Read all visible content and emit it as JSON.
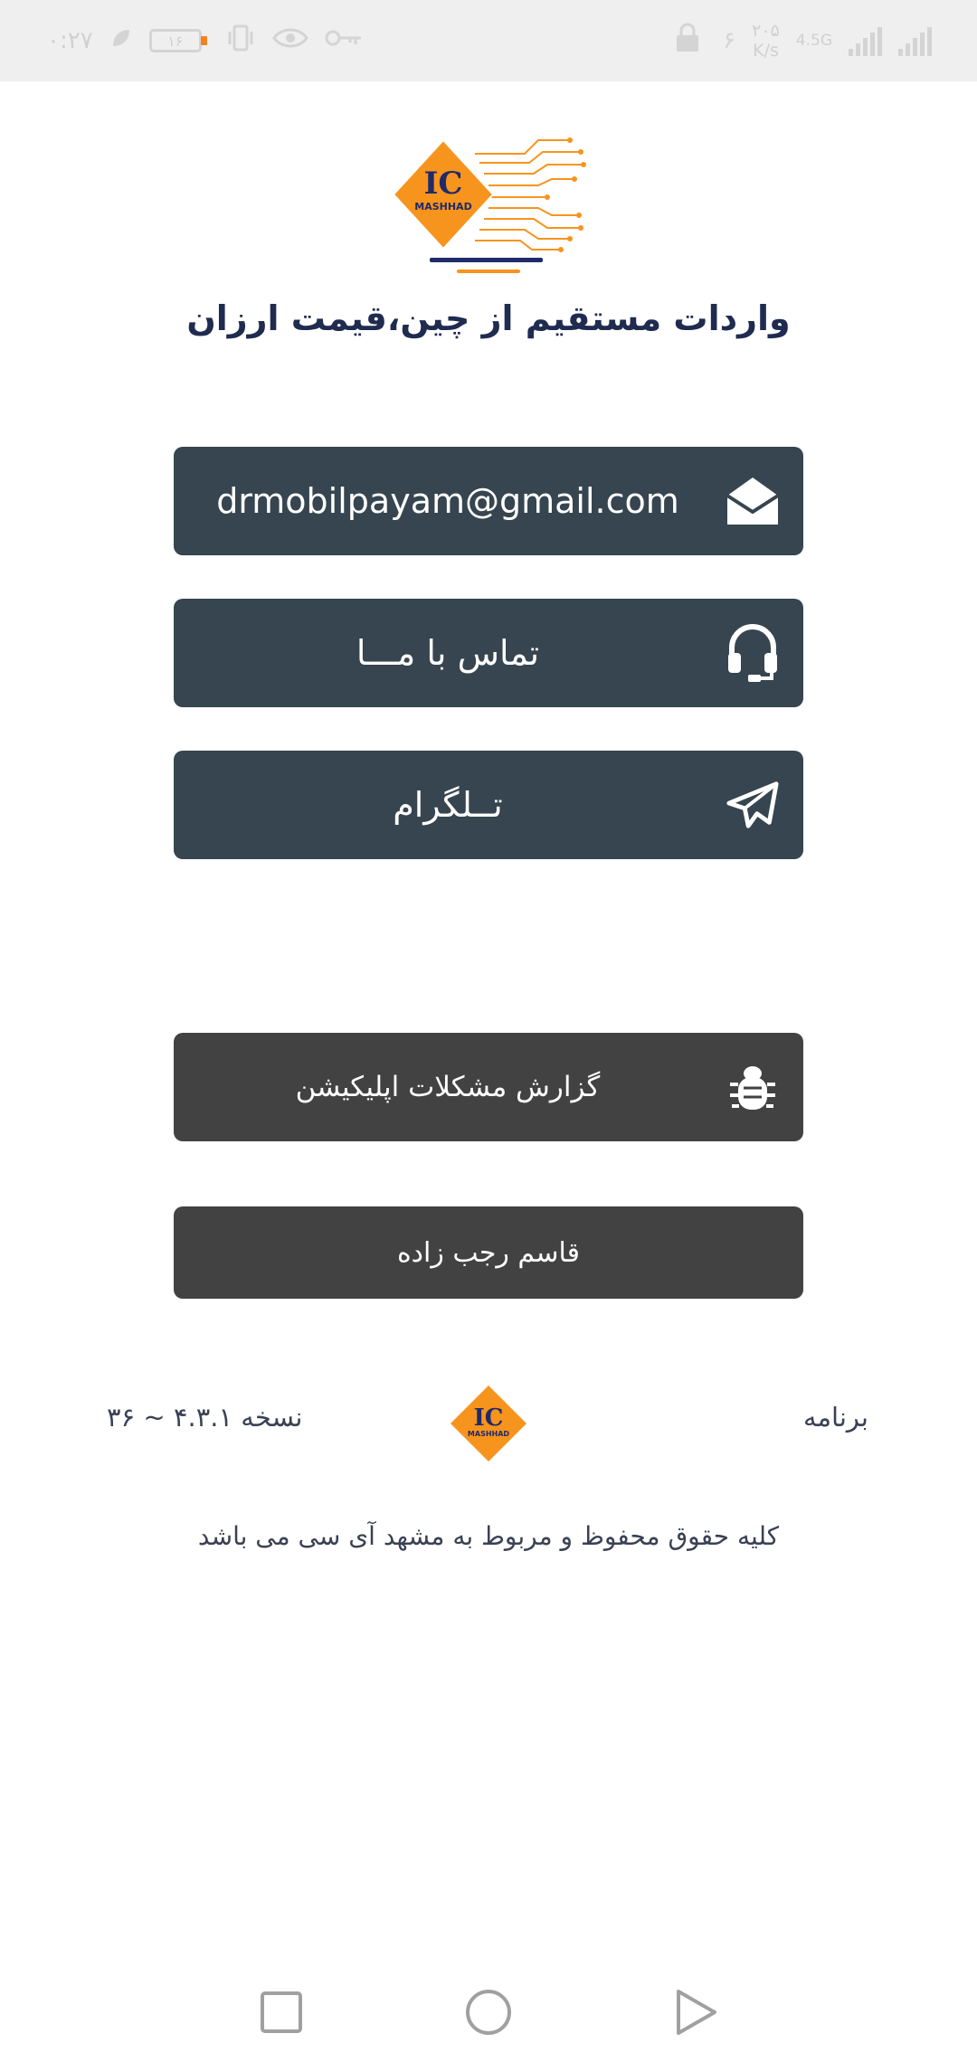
{
  "status_bar": {
    "time": "۰:۲۷",
    "battery": "۱۶",
    "speed_value": "۲۰۵",
    "speed_unit": "K/s",
    "network": "4.5G",
    "sim_indicator": "۶",
    "icons": [
      "leaf-icon",
      "battery-icon",
      "vibrate-icon",
      "eye-icon",
      "key-icon",
      "lock-icon",
      "signal-icon"
    ]
  },
  "header": {
    "logo_name": "ic-mashhad-logo",
    "headline": "واردات مستقیم از چین،قیمت ارزان"
  },
  "buttons": {
    "email": {
      "label": "drmobilpayam@gmail.com",
      "icon": "envelope-open-icon"
    },
    "contact": {
      "label": "تماس با مـــا",
      "icon": "headset-icon"
    },
    "telegram": {
      "label": "تــلگرام",
      "icon": "paper-plane-icon"
    },
    "report": {
      "label": "گزارش مشکلات اپلیکیشن",
      "icon": "bug-icon"
    },
    "author": {
      "label": "قاسم رجب زاده"
    }
  },
  "footer": {
    "program_label": "برنامه",
    "version_text": "نسخه ۴.۳.۱  ~  ۳۶",
    "copyright": "کلیه حقوق محفوظ و مربوط به مشهد آی سی می باشد"
  },
  "colors": {
    "primary_button": "#36454f",
    "secondary_button": "#424242",
    "headline": "#1f2b4f",
    "logo_orange": "#f7941d",
    "logo_navy": "#1f2a6b"
  },
  "nav": {
    "icons": [
      "recents-square-icon",
      "home-circle-icon",
      "back-triangle-icon"
    ]
  }
}
